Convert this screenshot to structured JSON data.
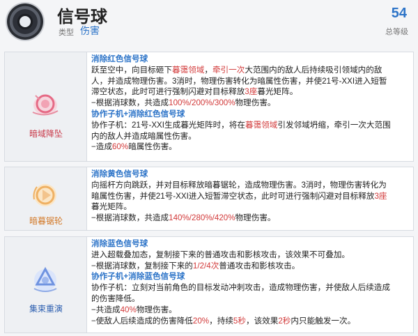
{
  "header": {
    "title": "信号球",
    "type_label": "类型",
    "type_value": "伤害",
    "level_value": "54",
    "level_label": "总等级",
    "logo_icon": "dark-orb-icon"
  },
  "colors": {
    "accent_blue": "#2d74c8",
    "highlight_red": "#d23a3a"
  },
  "skills": [
    {
      "name": "暗域降坠",
      "icon": "red-orb-icon",
      "sections": [
        {
          "title": "消除红色信号球"
        },
        {
          "line1a": "跃至空中，向目标砸下",
          "line1b": "暮霭领域",
          "line1c": "，",
          "line1d": "牵引一次",
          "line1e": "大范围内的敌人后持续吸引领域内的敌"
        },
        {
          "line2": "人，并造成物理伤害。3消时，物理伤害转化为暗属性伤害，并使21号-XXI进入短暂"
        },
        {
          "line3a": "滞空状态，此时可进行强制闪避对目标释放",
          "line3b": "3座",
          "line3c": "暮光矩阵。"
        },
        {
          "line4a": "−根据消球数，共造成",
          "line4b": "100%/200%/300%",
          "line4c": "物理伤害。"
        },
        {
          "title2": "协作子机+消除红色信号球"
        },
        {
          "line5a": "协作子机：21号-XXI生成暮光矩阵时，将在",
          "line5b": "暮霭领域",
          "line5c": "引发邻域坍缩，牵引一次大范围"
        },
        {
          "line6": "内的敌人并造成暗属性伤害。"
        },
        {
          "line7a": "−造成",
          "line7b": "60%",
          "line7c": "暗属性伤害。"
        }
      ]
    },
    {
      "name": "暗暮锯轮",
      "icon": "yellow-orb-icon",
      "title": "消除黄色信号球",
      "line1": "向摇杆方向跳跃，并对目标释放暗暮锯轮，造成物理伤害。3消时，物理伤害转化为",
      "line2a": "暗属性伤害，并使21号-XXI进入短暂滞空状态，此时可进行强制闪避对目标释放",
      "line2b": "3座",
      "line3": "暮光矩阵。",
      "line4a": "−根据消球数，共造成",
      "line4b": "140%/280%/420%",
      "line4c": "物理伤害。"
    },
    {
      "name": "集束重演",
      "icon": "blue-orb-icon",
      "title": "消除蓝色信号球",
      "line1": "进入超载叠加态，复制接下来的普通攻击和影核攻击，该效果不可叠加。",
      "line2a": "−根据消球数，复制接下来的",
      "line2b": "1/2/4次",
      "line2c": "普通攻击和影核攻击。",
      "title2": "协作子机+消除蓝色信号球",
      "line3": "协作子机：立刻对当前角色的目标发动冲刺攻击，造成物理伤害，并使敌人后续造成",
      "line4": "的伤害降低。",
      "line5a": "−共造成",
      "line5b": "40%",
      "line5c": "物理伤害。",
      "line6a": "−使敌人后续造成的伤害降低",
      "line6b": "20%",
      "line6c": "，持续",
      "line6d": "5秒",
      "line6e": "，该效果",
      "line6f": "2秒",
      "line6g": "内只能触发一次。"
    }
  ]
}
